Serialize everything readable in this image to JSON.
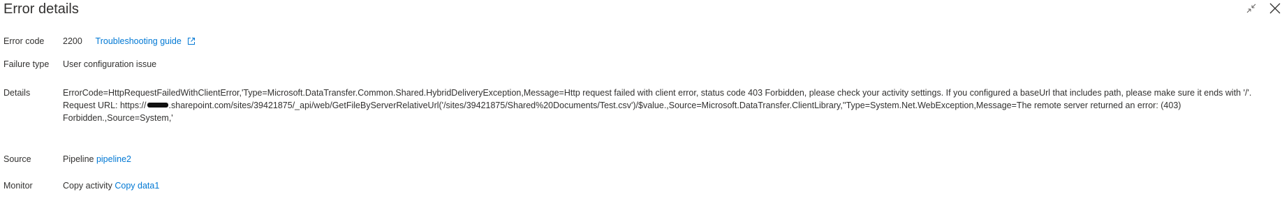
{
  "dialog": {
    "title": "Error details"
  },
  "error_code": {
    "label": "Error code",
    "value": "2200",
    "link_text": "Troubleshooting guide"
  },
  "failure_type": {
    "label": "Failure type",
    "value": "User configuration issue"
  },
  "details": {
    "label": "Details",
    "line1": "ErrorCode=HttpRequestFailedWithClientError,'Type=Microsoft.DataTransfer.Common.Shared.HybridDeliveryException,Message=Http request failed with client error, status code 403 Forbidden, please check your activity settings. If you configured a baseUrl that includes path, please make sure it ends with '/'.",
    "line2_prefix": "Request URL: https://",
    "line2_suffix": ".sharepoint.com/sites/39421875/_api/web/GetFileByServerRelativeUrl('/sites/39421875/Shared%20Documents/Test.csv')/$value.,Source=Microsoft.DataTransfer.ClientLibrary,''Type=System.Net.WebException,Message=The remote server returned an error: (403) Forbidden.,Source=System,'"
  },
  "source": {
    "label": "Source",
    "prefix": "Pipeline",
    "link_text": "pipeline2"
  },
  "monitor": {
    "label": "Monitor",
    "prefix": "Copy activity",
    "link_text": "Copy data1"
  },
  "icons": {
    "minimize": "collapse-icon",
    "close": "close-icon",
    "external": "external-link-icon"
  },
  "colors": {
    "link": "#0078d4",
    "text": "#323130"
  }
}
